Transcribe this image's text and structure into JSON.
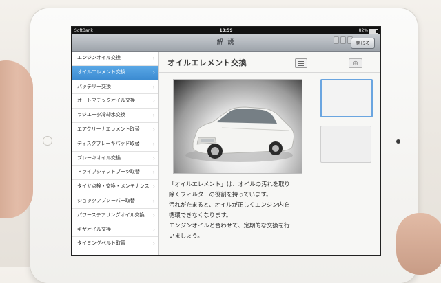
{
  "status_bar": {
    "carrier": "SoftBank",
    "time": "13:59",
    "battery": "82%"
  },
  "modal": {
    "title": "解 説",
    "close_label": "閉じる"
  },
  "sidebar": {
    "items": [
      {
        "label": "エンジンオイル交換",
        "active": false
      },
      {
        "label": "オイルエレメント交換",
        "active": true
      },
      {
        "label": "バッテリー交換",
        "active": false
      },
      {
        "label": "オートマチックオイル交換",
        "active": false
      },
      {
        "label": "ラジエータ冷却水交換",
        "active": false
      },
      {
        "label": "エアクリーナエレメント取替",
        "active": false
      },
      {
        "label": "ディスクブレーキパッド取替",
        "active": false
      },
      {
        "label": "ブレーキオイル交換",
        "active": false
      },
      {
        "label": "ドライブシャフトブーツ取替",
        "active": false
      },
      {
        "label": "タイヤ点検・交換・メンテナンス",
        "active": false
      },
      {
        "label": "ショックアブソーバー取替",
        "active": false
      },
      {
        "label": "パワーステアリングオイル交換",
        "active": false
      },
      {
        "label": "ギヤオイル交換",
        "active": false
      },
      {
        "label": "タイミングベルト取替",
        "active": false
      }
    ]
  },
  "content": {
    "title": "オイルエレメント交換",
    "description_lines": [
      "「オイルエレメント」は、オイルの汚れを取り",
      "除くフィルターの役割を持っています。",
      "汚れがたまると、オイルが正しくエンジン内を",
      "循環できなくなります。",
      "エンジンオイルと合わせて、定期的な交換を行",
      "いましょう。"
    ]
  },
  "icons": {
    "list": "list-icon",
    "ring": "settings-ring-icon",
    "chevron": "chevron-right-icon"
  },
  "colors": {
    "active_item": "#3c8bd1",
    "thumb_selected": "#6aa5e0"
  }
}
